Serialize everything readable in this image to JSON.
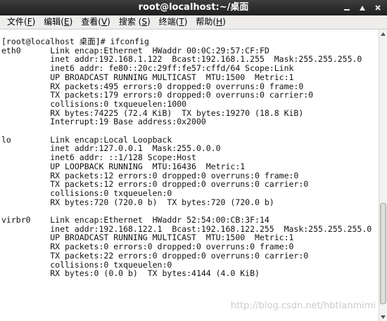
{
  "window": {
    "title": "root@localhost:~/桌面"
  },
  "menubar": {
    "items": [
      {
        "label": "文件(",
        "mnemonic": "F",
        "suffix": ")"
      },
      {
        "label": "编辑(",
        "mnemonic": "E",
        "suffix": ")"
      },
      {
        "label": "查看(",
        "mnemonic": "V",
        "suffix": ")"
      },
      {
        "label": "搜索 (",
        "mnemonic": "S",
        "suffix": ")"
      },
      {
        "label": "终端(",
        "mnemonic": "T",
        "suffix": ")"
      },
      {
        "label": "帮助(",
        "mnemonic": "H",
        "suffix": ")"
      }
    ]
  },
  "terminal": {
    "output": "[root@localhost 桌面]# ifconfig\neth0      Link encap:Ethernet  HWaddr 00:0C:29:57:CF:FD  \n          inet addr:192.168.1.122  Bcast:192.168.1.255  Mask:255.255.255.0\n          inet6 addr: fe80::20c:29ff:fe57:cffd/64 Scope:Link\n          UP BROADCAST RUNNING MULTICAST  MTU:1500  Metric:1\n          RX packets:495 errors:0 dropped:0 overruns:0 frame:0\n          TX packets:179 errors:0 dropped:0 overruns:0 carrier:0\n          collisions:0 txqueuelen:1000 \n          RX bytes:74225 (72.4 KiB)  TX bytes:19270 (18.8 KiB)\n          Interrupt:19 Base address:0x2000 \n\nlo        Link encap:Local Loopback  \n          inet addr:127.0.0.1  Mask:255.0.0.0\n          inet6 addr: ::1/128 Scope:Host\n          UP LOOPBACK RUNNING  MTU:16436  Metric:1\n          RX packets:12 errors:0 dropped:0 overruns:0 frame:0\n          TX packets:12 errors:0 dropped:0 overruns:0 carrier:0\n          collisions:0 txqueuelen:0 \n          RX bytes:720 (720.0 b)  TX bytes:720 (720.0 b)\n\nvirbr0    Link encap:Ethernet  HWaddr 52:54:00:CB:3F:14  \n          inet addr:192.168.122.1  Bcast:192.168.122.255  Mask:255.255.255.0\n          UP BROADCAST RUNNING MULTICAST  MTU:1500  Metric:1\n          RX packets:0 errors:0 dropped:0 overruns:0 frame:0\n          TX packets:22 errors:0 dropped:0 overruns:0 carrier:0\n          collisions:0 txqueuelen:0 \n          RX bytes:0 (0.0 b)  TX bytes:4144 (4.0 KiB)"
  },
  "scrollbar": {
    "thumb_start_fraction": 0.6,
    "thumb_end_fraction": 0.97
  },
  "watermark": {
    "text": "http://blog.csdn.net/hbtianmimi"
  },
  "icons": {
    "minimize": "minimize-icon",
    "maximize": "maximize-icon",
    "close": "close-icon"
  }
}
